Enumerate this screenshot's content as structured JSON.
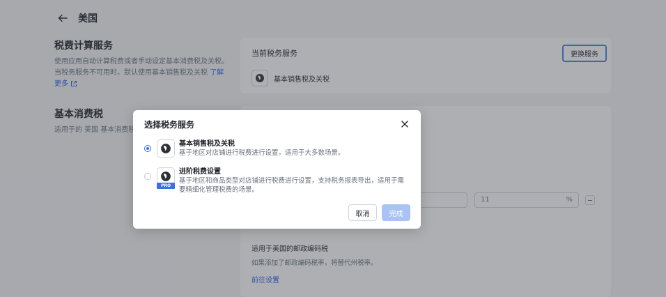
{
  "header": {
    "title": "美国"
  },
  "tax_service": {
    "title": "税费计算服务",
    "description": "使用应用自动计算税费或者手动设定基本消费税及关税。当税务服务不可用时，默认使用基本销售税及关税",
    "learn_more": "了解更多"
  },
  "current_service": {
    "title": "当前税务服务",
    "change_button": "更换服务",
    "service_name": "基本销售税及关税"
  },
  "basic_tax": {
    "title": "基本消费税",
    "description": "适用于的 美国 基本消费税"
  },
  "rate_row": {
    "value": "11",
    "unit": "%"
  },
  "zip_tax": {
    "title": "适用于美国的邮政编码税",
    "description": "如果添加了邮政编码税率，将替代州税率。",
    "link": "前往设置"
  },
  "modal": {
    "title": "选择税务服务",
    "options": [
      {
        "name": "基本销售税及关税",
        "description": "基于地区对店铺进行税费进行设置，适用于大多数场景。",
        "selected": true
      },
      {
        "name": "进阶税费设置",
        "description": "基于地区和商品类型对店铺进行税费进行设置，支持税务报表导出，适用于需要精细化管理税费的场景。",
        "selected": false,
        "badge": "PRO"
      }
    ],
    "cancel_label": "取消",
    "done_label": "完成"
  },
  "colors": {
    "accent": "#3b6ee8",
    "link": "#2563eb",
    "done_disabled": "#a9c3f5"
  },
  "icons": {
    "back": "arrow-left-icon",
    "close": "close-icon",
    "external": "external-link-icon",
    "service_logo": "service-logo-icon"
  }
}
